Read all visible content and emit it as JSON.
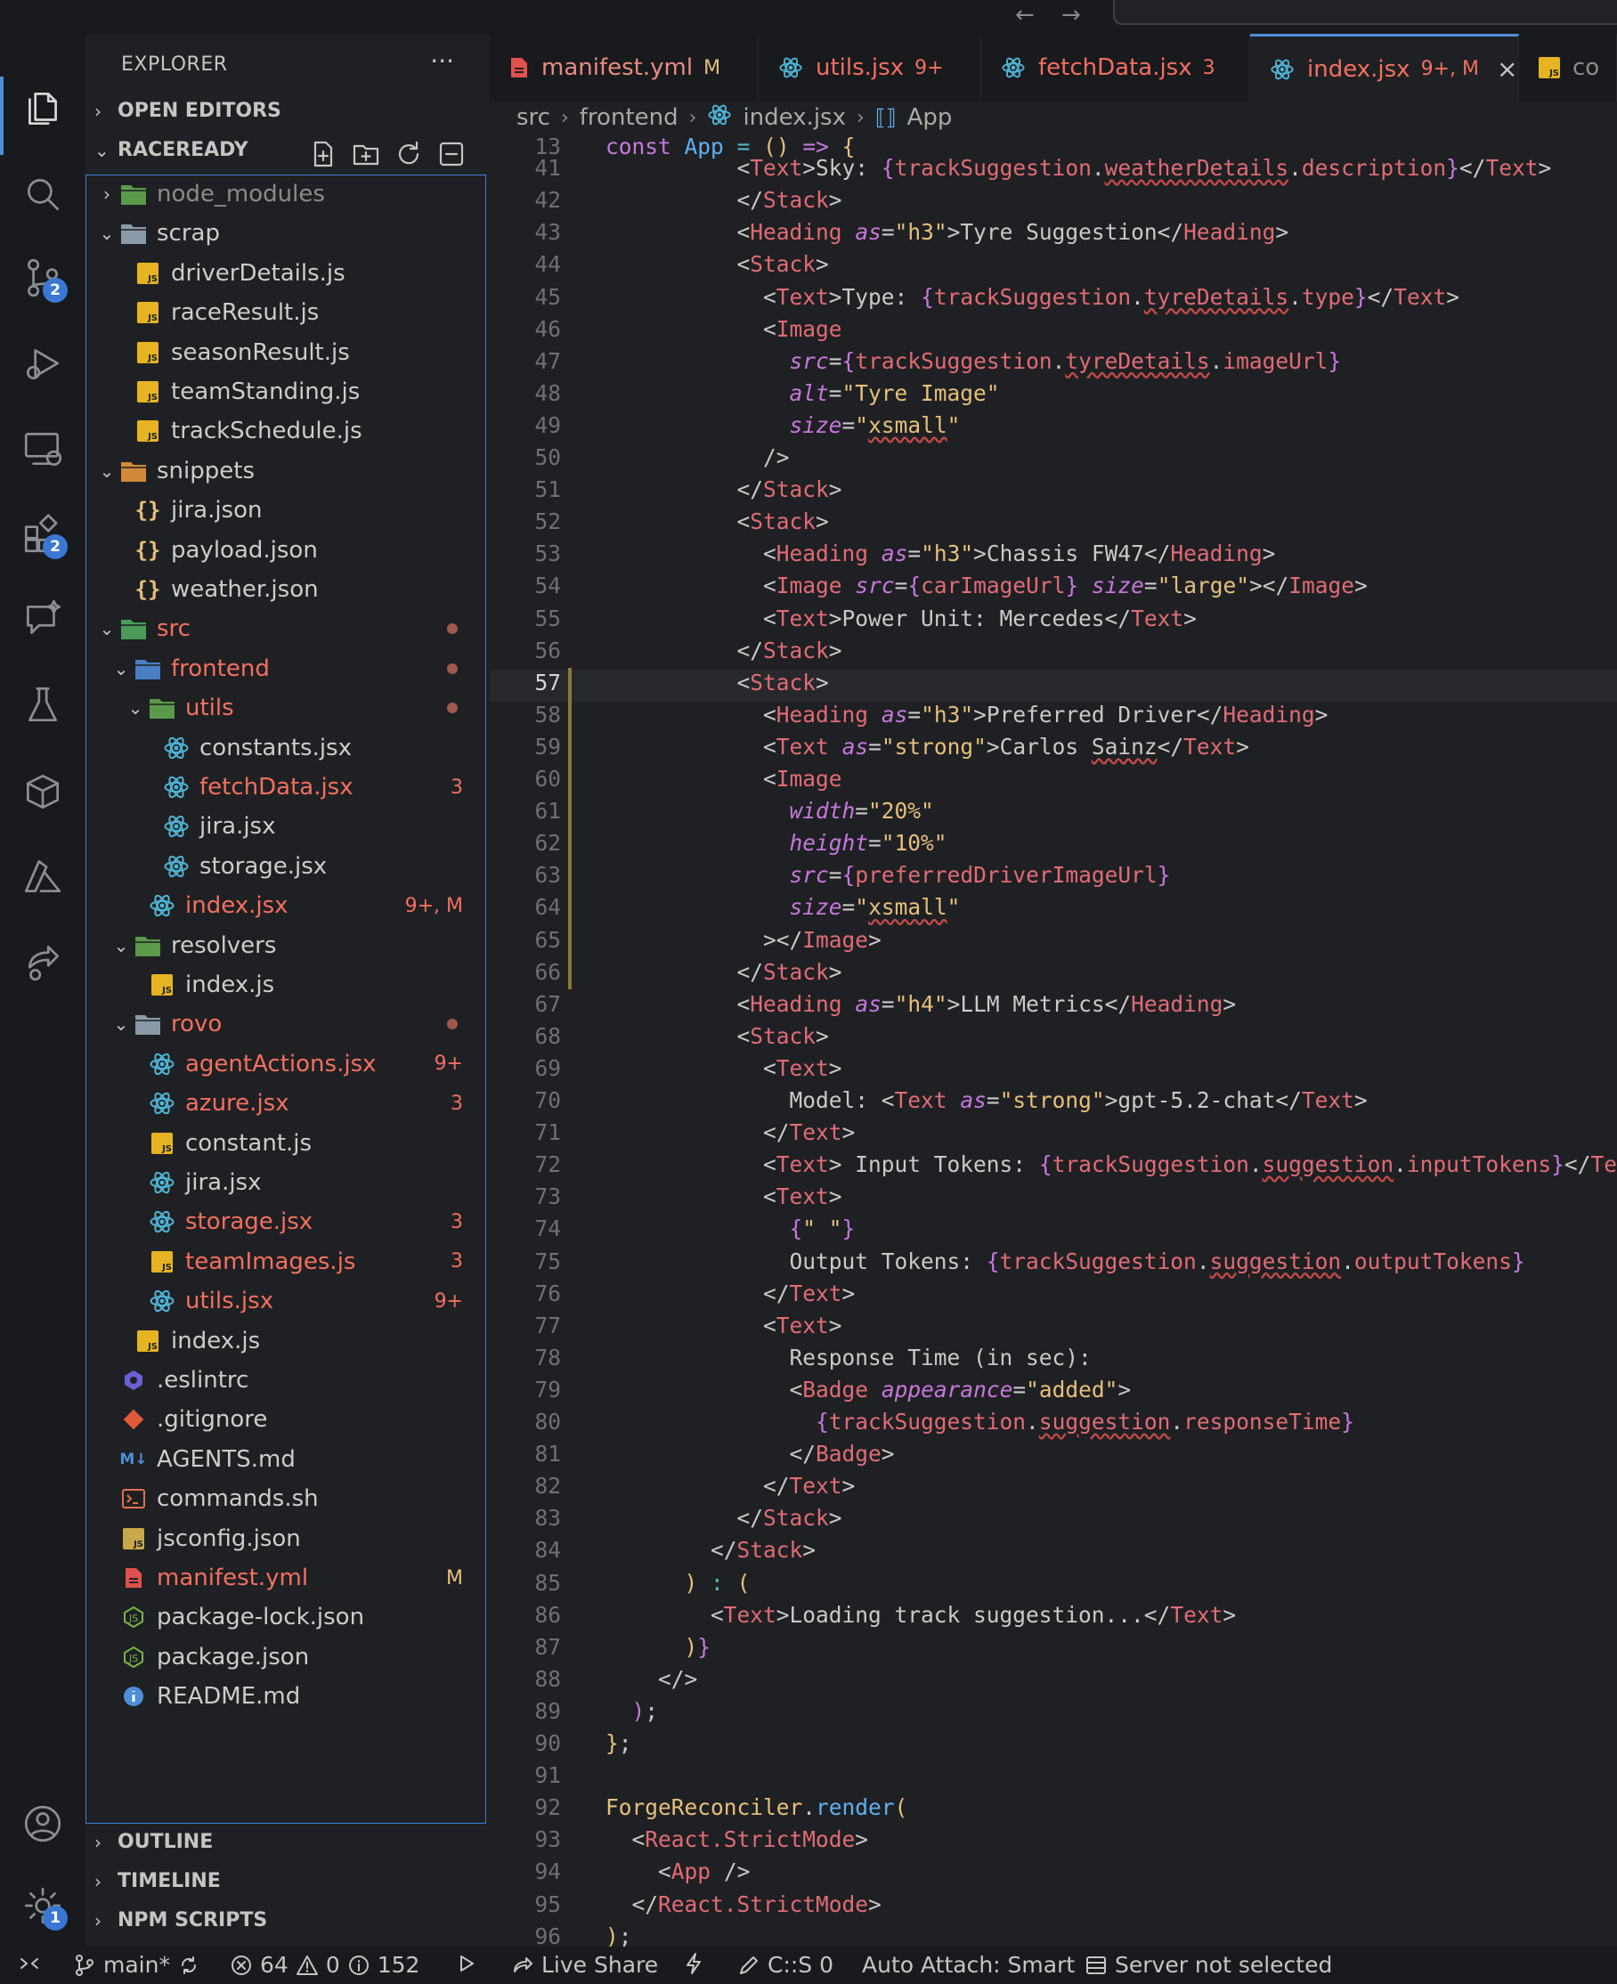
{
  "explorer": {
    "title": "EXPLORER",
    "more": "···",
    "open_editors": "OPEN EDITORS",
    "workspace": "RACEREADY",
    "outline": "OUTLINE",
    "timeline": "TIMELINE",
    "npm_scripts": "NPM SCRIPTS"
  },
  "tree": [
    {
      "label": "node_modules",
      "status": ""
    },
    {
      "label": "scrap",
      "status": ""
    },
    {
      "label": "driverDetails.js",
      "status": ""
    },
    {
      "label": "raceResult.js",
      "status": ""
    },
    {
      "label": "seasonResult.js",
      "status": ""
    },
    {
      "label": "teamStanding.js",
      "status": ""
    },
    {
      "label": "trackSchedule.js",
      "status": ""
    },
    {
      "label": "snippets",
      "status": ""
    },
    {
      "label": "jira.json",
      "status": ""
    },
    {
      "label": "payload.json",
      "status": ""
    },
    {
      "label": "weather.json",
      "status": ""
    },
    {
      "label": "src",
      "status": ""
    },
    {
      "label": "frontend",
      "status": ""
    },
    {
      "label": "utils",
      "status": ""
    },
    {
      "label": "constants.jsx",
      "status": ""
    },
    {
      "label": "fetchData.jsx",
      "status": "3"
    },
    {
      "label": "jira.jsx",
      "status": ""
    },
    {
      "label": "storage.jsx",
      "status": ""
    },
    {
      "label": "index.jsx",
      "status": "9+, M"
    },
    {
      "label": "resolvers",
      "status": ""
    },
    {
      "label": "index.js",
      "status": ""
    },
    {
      "label": "rovo",
      "status": ""
    },
    {
      "label": "agentActions.jsx",
      "status": "9+"
    },
    {
      "label": "azure.jsx",
      "status": "3"
    },
    {
      "label": "constant.js",
      "status": ""
    },
    {
      "label": "jira.jsx",
      "status": ""
    },
    {
      "label": "storage.jsx",
      "status": "3"
    },
    {
      "label": "teamImages.js",
      "status": "3"
    },
    {
      "label": "utils.jsx",
      "status": "9+"
    },
    {
      "label": "index.js",
      "status": ""
    },
    {
      "label": ".eslintrc",
      "status": ""
    },
    {
      "label": ".gitignore",
      "status": ""
    },
    {
      "label": "AGENTS.md",
      "status": ""
    },
    {
      "label": "commands.sh",
      "status": ""
    },
    {
      "label": "jsconfig.json",
      "status": ""
    },
    {
      "label": "manifest.yml",
      "status": "M"
    },
    {
      "label": "package-lock.json",
      "status": ""
    },
    {
      "label": "package.json",
      "status": ""
    },
    {
      "label": "README.md",
      "status": ""
    }
  ],
  "tabs": [
    {
      "label": "manifest.yml",
      "status": "M"
    },
    {
      "label": "utils.jsx",
      "status": "9+"
    },
    {
      "label": "fetchData.jsx",
      "status": "3"
    },
    {
      "label": "index.jsx",
      "status": "9+, M"
    },
    {
      "label": "co",
      "status": ""
    }
  ],
  "breadcrumb": [
    "src",
    "frontend",
    "index.jsx",
    "App"
  ],
  "line_numbers": [
    "13",
    "41",
    "42",
    "43",
    "44",
    "45",
    "46",
    "47",
    "48",
    "49",
    "50",
    "51",
    "52",
    "53",
    "54",
    "55",
    "56",
    "57",
    "58",
    "59",
    "60",
    "61",
    "62",
    "63",
    "64",
    "65",
    "66",
    "67",
    "68",
    "69",
    "70",
    "71",
    "72",
    "73",
    "74",
    "75",
    "76",
    "77",
    "78",
    "79",
    "80",
    "81",
    "82",
    "83",
    "84",
    "85",
    "86",
    "87",
    "88",
    "89",
    "90",
    "91",
    "92",
    "93",
    "94",
    "95",
    "96"
  ],
  "statusbar": {
    "branch": "main*",
    "errors": "64",
    "warnings": "0",
    "infos": "152",
    "live_share": "Live Share",
    "cs": "C::S 0",
    "auto_attach": "Auto Attach: Smart",
    "server": "Server not selected"
  },
  "badges": {
    "source_control": "2",
    "extensions": "2",
    "settings": "1"
  },
  "colors": {
    "accent": "#4e8ed8",
    "modified": "#f2705f",
    "background": "#1f2023"
  }
}
